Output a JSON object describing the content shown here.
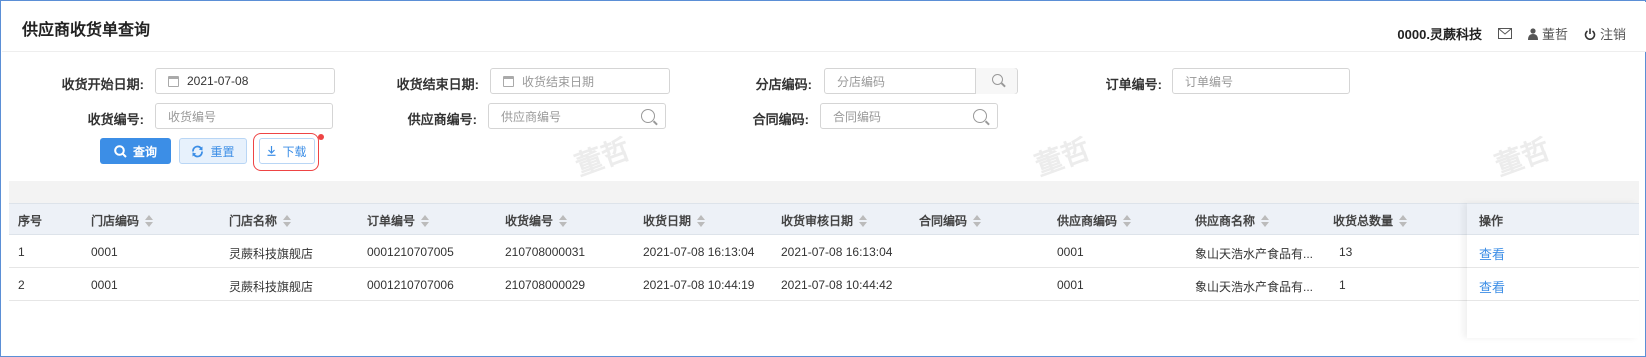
{
  "page_title": "供应商收货单查询",
  "header": {
    "company": "0000.灵蕨科技",
    "user": "董哲",
    "logout": "注销",
    "icons": [
      "mail-icon",
      "user-icon",
      "power-icon"
    ]
  },
  "filters": {
    "receive_start_label": "收货开始日期:",
    "receive_start_value": "2021-07-08",
    "receive_end_label": "收货结束日期:",
    "receive_end_placeholder": "收货结束日期",
    "branch_label": "分店编码:",
    "branch_placeholder": "分店编码",
    "order_label": "订单编号:",
    "order_placeholder": "订单编号",
    "receipt_label": "收货编号:",
    "receipt_placeholder": "收货编号",
    "supplier_label": "供应商编号:",
    "supplier_placeholder": "供应商编号",
    "contract_label": "合同编码:",
    "contract_placeholder": "合同编码"
  },
  "buttons": {
    "query": "查询",
    "reset": "重置",
    "download": "下载"
  },
  "watermark": "董哲",
  "table": {
    "columns": [
      "序号",
      "门店编码",
      "门店名称",
      "订单编号",
      "收货编号",
      "收货日期",
      "收货审核日期",
      "合同编码",
      "供应商编码",
      "供应商名称",
      "收货总数量",
      "操作"
    ],
    "rows": [
      [
        "1",
        "0001",
        "灵蕨科技旗舰店",
        "0001210707005",
        "210708000031",
        "2021-07-08 16:13:04",
        "2021-07-08 16:13:04",
        "",
        "0001",
        "象山天浩水产食品有...",
        "13",
        "查看"
      ],
      [
        "2",
        "0001",
        "灵蕨科技旗舰店",
        "0001210707006",
        "210708000029",
        "2021-07-08 10:44:19",
        "2021-07-08 10:44:42",
        "",
        "0001",
        "象山天浩水产食品有...",
        "1",
        "查看"
      ]
    ]
  },
  "colors": {
    "accent": "#3c8ee6",
    "header_bg": "#edf1f7",
    "highlight": "#e44444"
  }
}
